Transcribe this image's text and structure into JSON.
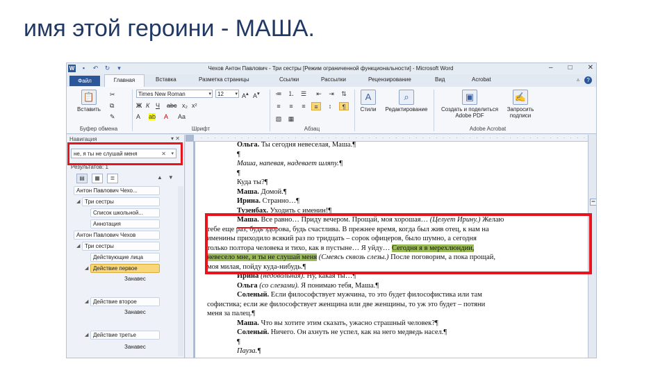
{
  "slide": {
    "title": "имя этой героини - МАША."
  },
  "window": {
    "title": "Чехов Антон Павлович - Три сестры [Режим ограниченной функциональности] - Microsoft Word",
    "controls": [
      "–",
      "□",
      "✕"
    ]
  },
  "ribbon_tabs": {
    "file": "Файл",
    "home": "Главная",
    "insert": "Вставка",
    "layout": "Разметка страницы",
    "refs": "Ссылки",
    "mailings": "Рассылки",
    "review": "Рецензирование",
    "view": "Вид",
    "acrobat": "Acrobat"
  },
  "ribbon": {
    "paste_label": "Вставить",
    "clipboard_label": "Буфер обмена",
    "font_name": "Times New Roman",
    "font_size": "12",
    "font_label": "Шрифт",
    "paragraph_label": "Абзац",
    "styles_label": "Стили",
    "editing_label": "Редактирование",
    "create_pdf_label": "Создать и поделиться Adobe PDF",
    "request_sign_label": "Запросить подписи",
    "acrobat_group_label": "Adobe Acrobat"
  },
  "nav_pane": {
    "header": "Навигация",
    "search_value": "не, я ты не слушай меня",
    "results": "Результатов: 1",
    "tree": [
      {
        "label": "Антон Павлович Чехо...",
        "selected": false
      },
      {
        "label": "Три сестры",
        "selected": false
      },
      {
        "label": "Список школьной...",
        "selected": false
      },
      {
        "label": "Аннотация",
        "selected": false
      },
      {
        "label": "Антон Павлович Чехов",
        "selected": false
      },
      {
        "label": "Три сестры",
        "selected": false
      },
      {
        "label": "Действующие лица",
        "selected": false
      },
      {
        "label": "Действие первое",
        "selected": true
      },
      {
        "label": "Занавес",
        "selected": false
      },
      {
        "label": "Действие второе",
        "selected": false
      },
      {
        "label": "Занавес",
        "selected": false
      },
      {
        "label": "Действие третье",
        "selected": false
      },
      {
        "label": "Занавес",
        "selected": false
      }
    ]
  },
  "document": {
    "lines": [
      {
        "speaker": "Ольга.",
        "text": " Ты сегодня невеселая, Маша.¶",
        "style": "",
        "full": false
      },
      {
        "speaker": "",
        "text": "¶",
        "style": "",
        "full": false
      },
      {
        "speaker": "",
        "text": "Маша, напевая, надевает шляпу.¶",
        "style": "it",
        "full": false
      },
      {
        "speaker": "",
        "text": "¶",
        "style": "",
        "full": false
      },
      {
        "speaker": "",
        "text": "Куда ты?¶",
        "style": "",
        "full": false
      },
      {
        "speaker": "Маша.",
        "text": " Домой.¶",
        "style": "",
        "full": false
      },
      {
        "speaker": "Ирина.",
        "text": " Странно…¶",
        "style": "",
        "full": false
      },
      {
        "speaker": "Тузенбах.",
        "text": " Уходить с именин!¶",
        "style": "",
        "full": false
      },
      {
        "speaker": "Маша.",
        "text": " Все равно… Приду вечером. Прощай, моя хорошая… ",
        "extra_it": "(Целует Ирину.)",
        "extra": " Желаю",
        "style": "",
        "full": false
      },
      {
        "speaker": "",
        "text": "тебе еще раз, будь здорова, будь счастлива. В прежнее время, когда был жив отец, к нам на",
        "style": "",
        "full": true
      },
      {
        "speaker": "",
        "text": "именины приходило всякий раз по тридцать – сорок офицеров, было шумно, а сегодня",
        "style": "",
        "full": true
      },
      {
        "speaker": "",
        "text": "только полтора человека и тихо, как в пустыне… Я уйду… ",
        "hl": "Сегодня я в мерехлюндии,",
        "style": "",
        "full": true
      },
      {
        "speaker": "",
        "text": "",
        "hl": "невесело мне, и ты не слушай меня",
        "extra_it": " (Смеясь сквозь слезы.)",
        "extra": " После поговорим, а пока прощай,",
        "style": "",
        "full": true
      },
      {
        "speaker": "",
        "text": "моя милая, пойду куда-нибудь.¶",
        "style": "",
        "full": true
      },
      {
        "speaker": "Ирина",
        "text": " ",
        "extra_it": "(недовольная).",
        "extra": " Ну, какая ты…¶",
        "style": "",
        "full": false
      },
      {
        "speaker": "Ольга",
        "text": " ",
        "extra_it": "(со слезами).",
        "extra": " Я понимаю тебя, Маша.¶",
        "style": "",
        "full": false
      },
      {
        "speaker": "Соленый.",
        "text": " Если философствует мужчина, то это будет философистика или там",
        "style": "",
        "full": false
      },
      {
        "speaker": "",
        "text": "софистика; если же философствует женщина или две женщины, то уж это будет – потяни",
        "style": "",
        "full": true
      },
      {
        "speaker": "",
        "text": "меня за палец.¶",
        "style": "",
        "full": true
      },
      {
        "speaker": "Маша.",
        "text": " Что вы хотите этим сказать, ужасно страшный человек?¶",
        "style": "",
        "full": false
      },
      {
        "speaker": "Соленый.",
        "text": " Ничего. Он ахнуть не успел, как на него медведь насел.¶",
        "style": "",
        "full": false
      },
      {
        "speaker": "",
        "text": "¶",
        "style": "",
        "full": false
      },
      {
        "speaker": "",
        "text": "Пауза.¶",
        "style": "it",
        "full": false
      }
    ]
  },
  "colors": {
    "annotation": "#e8141c",
    "search_highlight": "#9bbb59",
    "selected_tree": "#f8d77a"
  }
}
